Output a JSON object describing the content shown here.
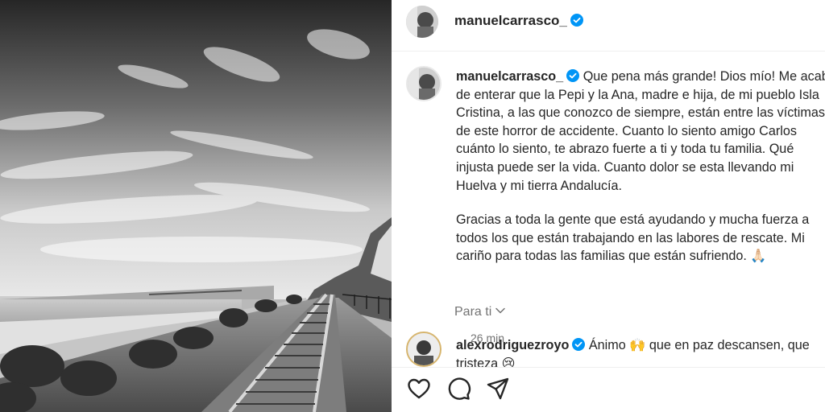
{
  "post": {
    "username": "manuelcarrasco_",
    "caption_p1": "Que pena más grande! Dios mío! Me acab\nde enterar que la Pepi y la Ana, madre e hija, de mi pueblo Isla\nCristina, a las que conozco de siempre, están entre las víctimas\nde este horror de accidente. Cuanto lo siento amigo Carlos\ncuánto lo siento, te abrazo fuerte a ti y toda tu familia. Qué\ninjusta puede ser la vida. Cuanto dolor se esta llevando mi\nHuelva y mi tierra Andalucía.",
    "caption_p2": "Gracias a toda la gente que está ayudando y mucha fuerza a\ntodos los que están trabajando en las labores de rescate. Mi\ncariño para todas las familias que están sufriendo. 🙏🏻",
    "time": "26 min"
  },
  "for_you": {
    "label": "Para ti"
  },
  "comment": {
    "username": "alexrodriguezroyo",
    "text": "Ánimo 🙌 que en paz descansen, que\ntristeza 😢"
  },
  "icons": {
    "like": "heart-icon",
    "comment": "comment-bubble-icon",
    "share": "paper-plane-icon",
    "verified": "verified-badge-icon",
    "chevron": "chevron-down-icon"
  },
  "colors": {
    "verified": "#0095f6",
    "secondary_text": "#737373"
  }
}
